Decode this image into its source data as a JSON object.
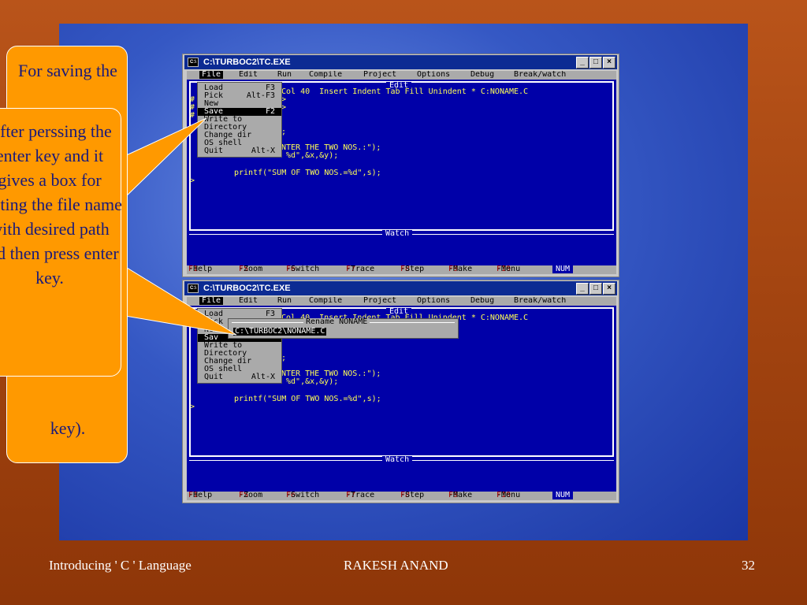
{
  "window": {
    "title": "C:\\TURBOC2\\TC.EXE",
    "minimize": "_",
    "maximize": "□",
    "close": "×"
  },
  "menu": {
    "file": "File",
    "edit": "Edit",
    "run": "Run",
    "compile": "Compile",
    "project": "Project",
    "options": "Options",
    "debug": "Debug",
    "break_watch": "Break/watch"
  },
  "editor": {
    "title": "Edit",
    "status": "Col 40  Insert Indent Tab Fill Unindent * C:NONAME.C",
    "code_lines": [
      ">",
      ">",
      ";",
      "NTER THE TWO NOS.:\");",
      " %d\",&x,&y);",
      "printf(\"SUM OF TWO NOS.=%d\",s);",
      ">"
    ],
    "left_gutter": [
      "#",
      "#",
      "#"
    ],
    "watch_title": "Watch"
  },
  "file_menu": {
    "items": [
      {
        "label": "Load",
        "key": "F3"
      },
      {
        "label": "Pick",
        "key": "Alt-F3"
      },
      {
        "label": "New",
        "key": ""
      },
      {
        "label": "Save",
        "key": "F2"
      },
      {
        "label": "Write to",
        "key": ""
      },
      {
        "label": "Directory",
        "key": ""
      },
      {
        "label": "Change dir",
        "key": ""
      },
      {
        "label": "OS shell",
        "key": ""
      },
      {
        "label": "Quit",
        "key": "Alt-X"
      }
    ],
    "save_partial": "Sav"
  },
  "rename_dialog": {
    "title": "Rename NONAME",
    "value": "C:\\TURBOC2\\NONAME.C"
  },
  "status_bar": {
    "items": [
      {
        "key": "F1",
        "label": "-Help"
      },
      {
        "key": "F5",
        "label": "-Zoom"
      },
      {
        "key": "F6",
        "label": "-Switch"
      },
      {
        "key": "F7",
        "label": "-Trace"
      },
      {
        "key": "F8",
        "label": "-Step"
      },
      {
        "key": "F9",
        "label": "-Make"
      },
      {
        "key": "F10",
        "label": "-Menu"
      }
    ],
    "num": "NUM"
  },
  "callouts": {
    "saving_top": "For saving the",
    "saving_bottom": "key).",
    "after": "After perssing the enter key and it gives a box for writing the file name with desired path and then press enter key."
  },
  "footer": {
    "left": "Introducing  ' C ' Language",
    "center": "RAKESH ANAND",
    "page": "32"
  },
  "colors": {
    "slide_bg": "#a74712",
    "frame_blue": "#2747b8",
    "callout": "#ff9900",
    "tc_blue": "#0000a8",
    "tc_yellow": "#ffff55"
  }
}
